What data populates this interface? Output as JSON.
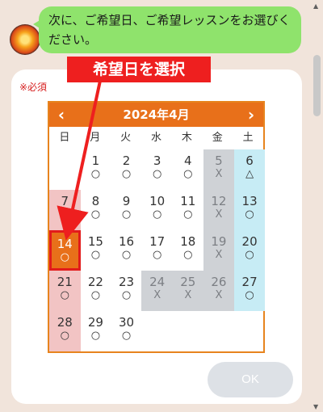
{
  "chat": {
    "message": "次に、ご希望日、ご希望レッスンをお選びください。"
  },
  "form": {
    "required_label": "※必須",
    "ok_label": "OK"
  },
  "annotation": {
    "text": "希望日を選択"
  },
  "calendar": {
    "title": "2024年4月",
    "weekdays": [
      "日",
      "月",
      "火",
      "水",
      "木",
      "金",
      "土"
    ],
    "days": [
      {
        "day": "1",
        "status": "○",
        "col": 1,
        "row": 0
      },
      {
        "day": "2",
        "status": "○",
        "col": 2,
        "row": 0
      },
      {
        "day": "3",
        "status": "○",
        "col": 3,
        "row": 0
      },
      {
        "day": "4",
        "status": "○",
        "col": 4,
        "row": 0
      },
      {
        "day": "5",
        "status": "X",
        "col": 5,
        "row": 0,
        "closed": true
      },
      {
        "day": "6",
        "status": "△",
        "col": 6,
        "row": 0
      },
      {
        "day": "7",
        "status": "△",
        "col": 0,
        "row": 1
      },
      {
        "day": "8",
        "status": "○",
        "col": 1,
        "row": 1
      },
      {
        "day": "9",
        "status": "○",
        "col": 2,
        "row": 1
      },
      {
        "day": "10",
        "status": "○",
        "col": 3,
        "row": 1
      },
      {
        "day": "11",
        "status": "○",
        "col": 4,
        "row": 1
      },
      {
        "day": "12",
        "status": "X",
        "col": 5,
        "row": 1,
        "closed": true
      },
      {
        "day": "13",
        "status": "○",
        "col": 6,
        "row": 1
      },
      {
        "day": "14",
        "status": "○",
        "col": 0,
        "row": 2,
        "selected": true
      },
      {
        "day": "15",
        "status": "○",
        "col": 1,
        "row": 2
      },
      {
        "day": "16",
        "status": "○",
        "col": 2,
        "row": 2
      },
      {
        "day": "17",
        "status": "○",
        "col": 3,
        "row": 2
      },
      {
        "day": "18",
        "status": "○",
        "col": 4,
        "row": 2
      },
      {
        "day": "19",
        "status": "X",
        "col": 5,
        "row": 2,
        "closed": true
      },
      {
        "day": "20",
        "status": "○",
        "col": 6,
        "row": 2
      },
      {
        "day": "21",
        "status": "○",
        "col": 0,
        "row": 3
      },
      {
        "day": "22",
        "status": "○",
        "col": 1,
        "row": 3
      },
      {
        "day": "23",
        "status": "○",
        "col": 2,
        "row": 3
      },
      {
        "day": "24",
        "status": "X",
        "col": 3,
        "row": 3,
        "closed": true
      },
      {
        "day": "25",
        "status": "X",
        "col": 4,
        "row": 3,
        "closed": true
      },
      {
        "day": "26",
        "status": "X",
        "col": 5,
        "row": 3,
        "closed": true
      },
      {
        "day": "27",
        "status": "○",
        "col": 6,
        "row": 3
      },
      {
        "day": "28",
        "status": "○",
        "col": 0,
        "row": 4
      },
      {
        "day": "29",
        "status": "○",
        "col": 1,
        "row": 4
      },
      {
        "day": "30",
        "status": "○",
        "col": 2,
        "row": 4
      }
    ]
  },
  "icons": {
    "prev": "chevron-left-icon",
    "next": "chevron-right-icon"
  },
  "colors": {
    "accent": "#e8701a",
    "chat_bubble": "#8fe36c",
    "annotation": "#ee1f1f"
  }
}
